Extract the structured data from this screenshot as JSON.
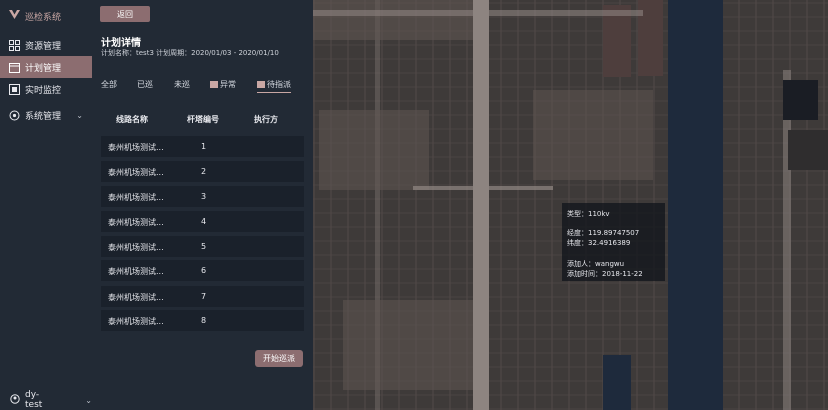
{
  "app": {
    "logo_text": "巡检系统"
  },
  "sidebar": {
    "items": [
      {
        "label": "资源管理",
        "icon": "grid-icon"
      },
      {
        "label": "计划管理",
        "icon": "calendar-icon"
      },
      {
        "label": "实时监控",
        "icon": "monitor-icon"
      },
      {
        "label": "系统管理",
        "icon": "gear-icon"
      }
    ],
    "user": "dy-test"
  },
  "panel": {
    "back_label": "返回",
    "title": "计划详情",
    "subtitle": "计划名称：test3 计划周期：2020/01/03 - 2020/01/10",
    "tabs": [
      "全部",
      "已巡",
      "未巡",
      "异常",
      "待指派"
    ],
    "columns": [
      "线路名称",
      "杆塔编号",
      "执行方"
    ],
    "rows": [
      {
        "name": "泰州机场测试...",
        "num": "1"
      },
      {
        "name": "泰州机场测试...",
        "num": "2"
      },
      {
        "name": "泰州机场测试...",
        "num": "3"
      },
      {
        "name": "泰州机场测试...",
        "num": "4"
      },
      {
        "name": "泰州机场测试...",
        "num": "5"
      },
      {
        "name": "泰州机场测试...",
        "num": "6"
      },
      {
        "name": "泰州机场测试...",
        "num": "7"
      },
      {
        "name": "泰州机场测试...",
        "num": "8"
      }
    ],
    "start_label": "开始巡派"
  },
  "map_popup": {
    "type": "类型：110kv",
    "lng": "经度：119.89747507",
    "lat": "纬度：32.4916389",
    "adder": "添加人：wangwu",
    "time": "添加时间：2018-11-22"
  },
  "colors": {
    "accent": "#8c6d70",
    "sidebar_bg": "#222a35",
    "row_bg": "#1a212b"
  }
}
